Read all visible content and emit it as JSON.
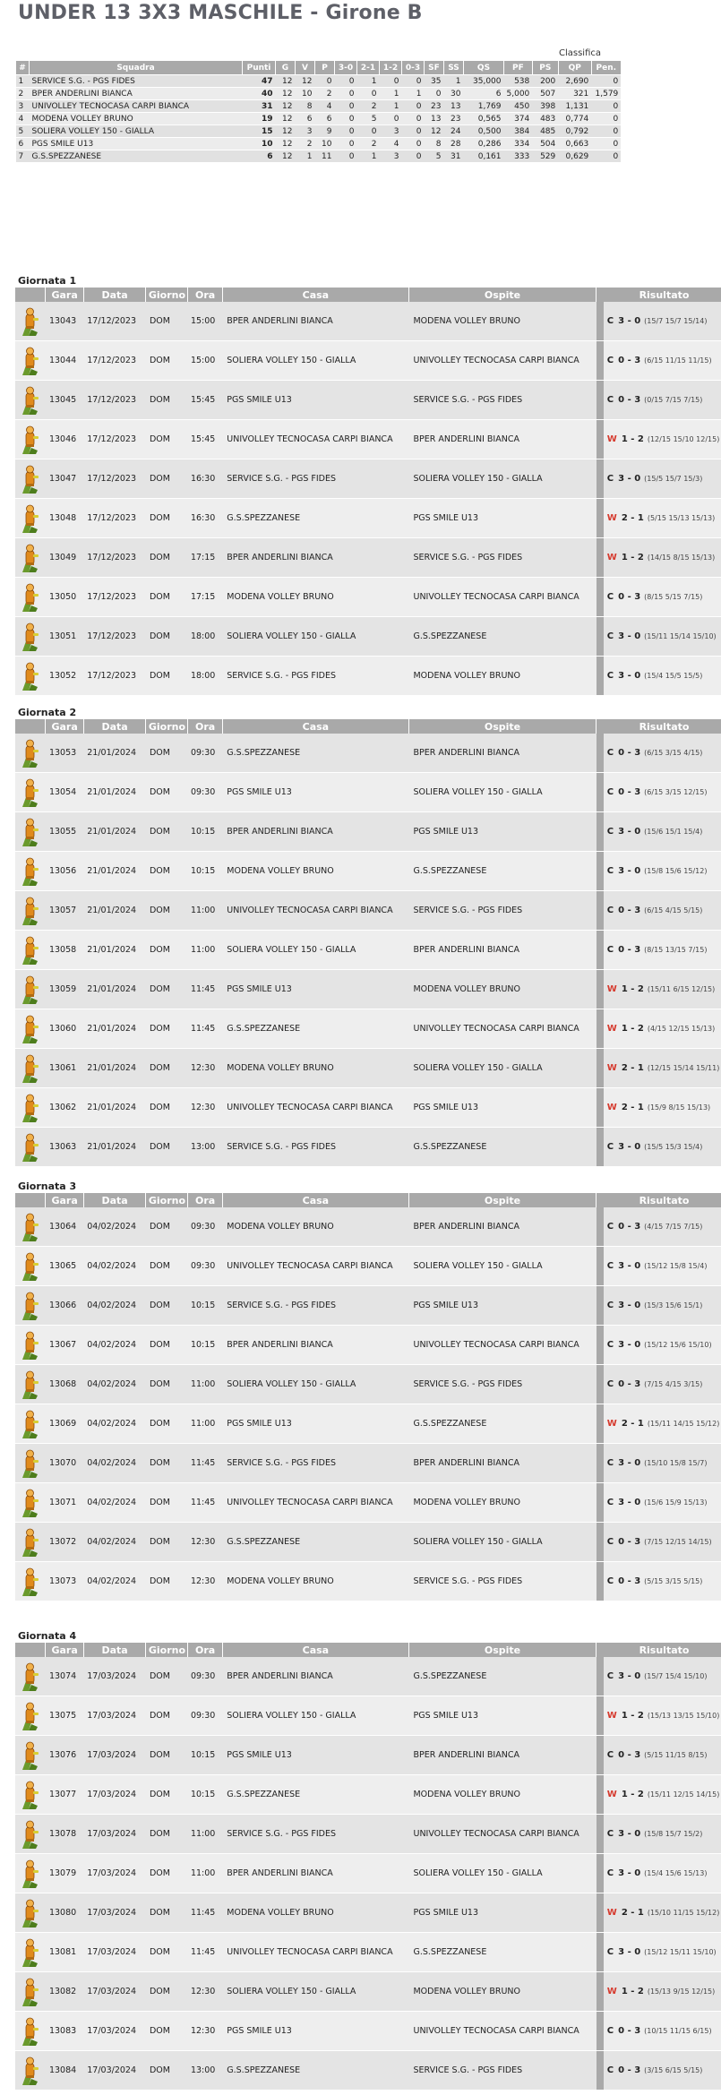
{
  "title": "UNDER 13 3X3 MASCHILE - Girone B",
  "standings_caption": "Classifica",
  "standings_headers": [
    "#",
    "Squadra",
    "Punti",
    "G",
    "V",
    "P",
    "3-0",
    "2-1",
    "1-2",
    "0-3",
    "SF",
    "SS",
    "QS",
    "PF",
    "PS",
    "QP",
    "Pen."
  ],
  "standings": [
    {
      "rank": "1",
      "team": "SERVICE S.G. - PGS FIDES",
      "punti": "47",
      "g": "12",
      "v": "12",
      "p": "0",
      "s30": "0",
      "s21": "1",
      "s12": "0",
      "s03": "0",
      "sf": "35",
      "ss": "1",
      "qs": "35,000",
      "pf": "538",
      "ps": "200",
      "qp": "2,690",
      "pen": "0"
    },
    {
      "rank": "2",
      "team": "BPER ANDERLINI BIANCA",
      "punti": "40",
      "g": "12",
      "v": "10",
      "p": "2",
      "s30": "0",
      "s21": "0",
      "s12": "1",
      "s03": "1",
      "sf": "0",
      "ss": "30",
      "qs": "6",
      "pf": "5,000",
      "ps": "507",
      "qp": "321",
      "pen": "1,579",
      "pen2": "0"
    },
    {
      "rank": "3",
      "team": "UNIVOLLEY TECNOCASA CARPI BIANCA",
      "punti": "31",
      "g": "12",
      "v": "8",
      "p": "4",
      "s30": "0",
      "s21": "2",
      "s12": "1",
      "s03": "0",
      "sf": "23",
      "ss": "13",
      "qs": "1,769",
      "pf": "450",
      "ps": "398",
      "qp": "1,131",
      "pen": "0"
    },
    {
      "rank": "4",
      "team": "MODENA VOLLEY BRUNO",
      "punti": "19",
      "g": "12",
      "v": "6",
      "p": "6",
      "s30": "0",
      "s21": "5",
      "s12": "0",
      "s03": "0",
      "sf": "13",
      "ss": "23",
      "qs": "0,565",
      "pf": "374",
      "ps": "483",
      "qp": "0,774",
      "pen": "0"
    },
    {
      "rank": "5",
      "team": "SOLIERA VOLLEY 150 - GIALLA",
      "punti": "15",
      "g": "12",
      "v": "3",
      "p": "9",
      "s30": "0",
      "s21": "0",
      "s12": "3",
      "s03": "0",
      "sf": "12",
      "ss": "24",
      "qs": "0,500",
      "pf": "384",
      "ps": "485",
      "qp": "0,792",
      "pen": "0"
    },
    {
      "rank": "6",
      "team": "PGS SMILE U13",
      "punti": "10",
      "g": "12",
      "v": "2",
      "p": "10",
      "s30": "0",
      "s21": "2",
      "s12": "4",
      "s03": "0",
      "sf": "8",
      "ss": "28",
      "qs": "0,286",
      "pf": "334",
      "ps": "504",
      "qp": "0,663",
      "pen": "0"
    },
    {
      "rank": "7",
      "team": "G.S.SPEZZANESE",
      "punti": "6",
      "g": "12",
      "v": "1",
      "p": "11",
      "s30": "0",
      "s21": "1",
      "s12": "3",
      "s03": "0",
      "sf": "5",
      "ss": "31",
      "qs": "0,161",
      "pf": "333",
      "ps": "529",
      "qp": "0,629",
      "pen": "0"
    }
  ],
  "games_headers": [
    "Gara",
    "Data",
    "Giorno",
    "Ora",
    "Casa",
    "Ospite",
    "Risultato"
  ],
  "giornate": [
    {
      "label": "Giornata 1",
      "games": [
        {
          "gara": "13043",
          "data": "17/12/2023",
          "giorno": "DOM",
          "ora": "15:00",
          "casa": "BPER ANDERLINI BIANCA",
          "ospite": "MODENA VOLLEY BRUNO",
          "flag": "C",
          "score": "3 - 0",
          "sets": "(15/7 15/7 15/14)"
        },
        {
          "gara": "13044",
          "data": "17/12/2023",
          "giorno": "DOM",
          "ora": "15:00",
          "casa": "SOLIERA VOLLEY 150 - GIALLA",
          "ospite": "UNIVOLLEY TECNOCASA CARPI BIANCA",
          "flag": "C",
          "score": "0 - 3",
          "sets": "(6/15 11/15 11/15)"
        },
        {
          "gara": "13045",
          "data": "17/12/2023",
          "giorno": "DOM",
          "ora": "15:45",
          "casa": "PGS SMILE U13",
          "ospite": "SERVICE S.G. - PGS FIDES",
          "flag": "C",
          "score": "0 - 3",
          "sets": "(0/15 7/15 7/15)"
        },
        {
          "gara": "13046",
          "data": "17/12/2023",
          "giorno": "DOM",
          "ora": "15:45",
          "casa": "UNIVOLLEY TECNOCASA CARPI BIANCA",
          "ospite": "BPER ANDERLINI BIANCA",
          "flag": "W",
          "score": "1 - 2",
          "sets": "(12/15 15/10 12/15)"
        },
        {
          "gara": "13047",
          "data": "17/12/2023",
          "giorno": "DOM",
          "ora": "16:30",
          "casa": "SERVICE S.G. - PGS FIDES",
          "ospite": "SOLIERA VOLLEY 150 - GIALLA",
          "flag": "C",
          "score": "3 - 0",
          "sets": "(15/5 15/7 15/3)"
        },
        {
          "gara": "13048",
          "data": "17/12/2023",
          "giorno": "DOM",
          "ora": "16:30",
          "casa": "G.S.SPEZZANESE",
          "ospite": "PGS SMILE U13",
          "flag": "W",
          "score": "2 - 1",
          "sets": "(5/15 15/13 15/13)"
        },
        {
          "gara": "13049",
          "data": "17/12/2023",
          "giorno": "DOM",
          "ora": "17:15",
          "casa": "BPER ANDERLINI BIANCA",
          "ospite": "SERVICE S.G. - PGS FIDES",
          "flag": "W",
          "score": "1 - 2",
          "sets": "(14/15 8/15 15/13)"
        },
        {
          "gara": "13050",
          "data": "17/12/2023",
          "giorno": "DOM",
          "ora": "17:15",
          "casa": "MODENA VOLLEY BRUNO",
          "ospite": "UNIVOLLEY TECNOCASA CARPI BIANCA",
          "flag": "C",
          "score": "0 - 3",
          "sets": "(8/15 5/15 7/15)"
        },
        {
          "gara": "13051",
          "data": "17/12/2023",
          "giorno": "DOM",
          "ora": "18:00",
          "casa": "SOLIERA VOLLEY 150 - GIALLA",
          "ospite": "G.S.SPEZZANESE",
          "flag": "C",
          "score": "3 - 0",
          "sets": "(15/11 15/14 15/10)"
        },
        {
          "gara": "13052",
          "data": "17/12/2023",
          "giorno": "DOM",
          "ora": "18:00",
          "casa": "SERVICE S.G. - PGS FIDES",
          "ospite": "MODENA VOLLEY BRUNO",
          "flag": "C",
          "score": "3 - 0",
          "sets": "(15/4 15/5 15/5)"
        }
      ]
    },
    {
      "label": "Giornata 2",
      "games": [
        {
          "gara": "13053",
          "data": "21/01/2024",
          "giorno": "DOM",
          "ora": "09:30",
          "casa": "G.S.SPEZZANESE",
          "ospite": "BPER ANDERLINI BIANCA",
          "flag": "C",
          "score": "0 - 3",
          "sets": "(6/15 3/15 4/15)"
        },
        {
          "gara": "13054",
          "data": "21/01/2024",
          "giorno": "DOM",
          "ora": "09:30",
          "casa": "PGS SMILE U13",
          "ospite": "SOLIERA VOLLEY 150 - GIALLA",
          "flag": "C",
          "score": "0 - 3",
          "sets": "(6/15 3/15 12/15)"
        },
        {
          "gara": "13055",
          "data": "21/01/2024",
          "giorno": "DOM",
          "ora": "10:15",
          "casa": "BPER ANDERLINI BIANCA",
          "ospite": "PGS SMILE U13",
          "flag": "C",
          "score": "3 - 0",
          "sets": "(15/6 15/1 15/4)"
        },
        {
          "gara": "13056",
          "data": "21/01/2024",
          "giorno": "DOM",
          "ora": "10:15",
          "casa": "MODENA VOLLEY BRUNO",
          "ospite": "G.S.SPEZZANESE",
          "flag": "C",
          "score": "3 - 0",
          "sets": "(15/8 15/6 15/12)"
        },
        {
          "gara": "13057",
          "data": "21/01/2024",
          "giorno": "DOM",
          "ora": "11:00",
          "casa": "UNIVOLLEY TECNOCASA CARPI BIANCA",
          "ospite": "SERVICE S.G. - PGS FIDES",
          "flag": "C",
          "score": "0 - 3",
          "sets": "(6/15 4/15 5/15)"
        },
        {
          "gara": "13058",
          "data": "21/01/2024",
          "giorno": "DOM",
          "ora": "11:00",
          "casa": "SOLIERA VOLLEY 150 - GIALLA",
          "ospite": "BPER ANDERLINI BIANCA",
          "flag": "C",
          "score": "0 - 3",
          "sets": "(8/15 13/15 7/15)"
        },
        {
          "gara": "13059",
          "data": "21/01/2024",
          "giorno": "DOM",
          "ora": "11:45",
          "casa": "PGS SMILE U13",
          "ospite": "MODENA VOLLEY BRUNO",
          "flag": "W",
          "score": "1 - 2",
          "sets": "(15/11 6/15 12/15)"
        },
        {
          "gara": "13060",
          "data": "21/01/2024",
          "giorno": "DOM",
          "ora": "11:45",
          "casa": "G.S.SPEZZANESE",
          "ospite": "UNIVOLLEY TECNOCASA CARPI BIANCA",
          "flag": "W",
          "score": "1 - 2",
          "sets": "(4/15 12/15 15/13)"
        },
        {
          "gara": "13061",
          "data": "21/01/2024",
          "giorno": "DOM",
          "ora": "12:30",
          "casa": "MODENA VOLLEY BRUNO",
          "ospite": "SOLIERA VOLLEY 150 - GIALLA",
          "flag": "W",
          "score": "2 - 1",
          "sets": "(12/15 15/14 15/11)"
        },
        {
          "gara": "13062",
          "data": "21/01/2024",
          "giorno": "DOM",
          "ora": "12:30",
          "casa": "UNIVOLLEY TECNOCASA CARPI BIANCA",
          "ospite": "PGS SMILE U13",
          "flag": "W",
          "score": "2 - 1",
          "sets": "(15/9 8/15 15/13)"
        },
        {
          "gara": "13063",
          "data": "21/01/2024",
          "giorno": "DOM",
          "ora": "13:00",
          "casa": "SERVICE S.G. - PGS FIDES",
          "ospite": "G.S.SPEZZANESE",
          "flag": "C",
          "score": "3 - 0",
          "sets": "(15/5 15/3 15/4)"
        }
      ]
    },
    {
      "label": "Giornata 3",
      "games": [
        {
          "gara": "13064",
          "data": "04/02/2024",
          "giorno": "DOM",
          "ora": "09:30",
          "casa": "MODENA VOLLEY BRUNO",
          "ospite": "BPER ANDERLINI BIANCA",
          "flag": "C",
          "score": "0 - 3",
          "sets": "(4/15 7/15 7/15)"
        },
        {
          "gara": "13065",
          "data": "04/02/2024",
          "giorno": "DOM",
          "ora": "09:30",
          "casa": "UNIVOLLEY TECNOCASA CARPI BIANCA",
          "ospite": "SOLIERA VOLLEY 150 - GIALLA",
          "flag": "C",
          "score": "3 - 0",
          "sets": "(15/12 15/8 15/4)"
        },
        {
          "gara": "13066",
          "data": "04/02/2024",
          "giorno": "DOM",
          "ora": "10:15",
          "casa": "SERVICE S.G. - PGS FIDES",
          "ospite": "PGS SMILE U13",
          "flag": "C",
          "score": "3 - 0",
          "sets": "(15/3 15/6 15/1)"
        },
        {
          "gara": "13067",
          "data": "04/02/2024",
          "giorno": "DOM",
          "ora": "10:15",
          "casa": "BPER ANDERLINI BIANCA",
          "ospite": "UNIVOLLEY TECNOCASA CARPI BIANCA",
          "flag": "C",
          "score": "3 - 0",
          "sets": "(15/12 15/6 15/10)"
        },
        {
          "gara": "13068",
          "data": "04/02/2024",
          "giorno": "DOM",
          "ora": "11:00",
          "casa": "SOLIERA VOLLEY 150 - GIALLA",
          "ospite": "SERVICE S.G. - PGS FIDES",
          "flag": "C",
          "score": "0 - 3",
          "sets": "(7/15 4/15 3/15)"
        },
        {
          "gara": "13069",
          "data": "04/02/2024",
          "giorno": "DOM",
          "ora": "11:00",
          "casa": "PGS SMILE U13",
          "ospite": "G.S.SPEZZANESE",
          "flag": "W",
          "score": "2 - 1",
          "sets": "(15/11 14/15 15/12)"
        },
        {
          "gara": "13070",
          "data": "04/02/2024",
          "giorno": "DOM",
          "ora": "11:45",
          "casa": "SERVICE S.G. - PGS FIDES",
          "ospite": "BPER ANDERLINI BIANCA",
          "flag": "C",
          "score": "3 - 0",
          "sets": "(15/10 15/8 15/7)"
        },
        {
          "gara": "13071",
          "data": "04/02/2024",
          "giorno": "DOM",
          "ora": "11:45",
          "casa": "UNIVOLLEY TECNOCASA CARPI BIANCA",
          "ospite": "MODENA VOLLEY BRUNO",
          "flag": "C",
          "score": "3 - 0",
          "sets": "(15/6 15/9 15/13)"
        },
        {
          "gara": "13072",
          "data": "04/02/2024",
          "giorno": "DOM",
          "ora": "12:30",
          "casa": "G.S.SPEZZANESE",
          "ospite": "SOLIERA VOLLEY 150 - GIALLA",
          "flag": "C",
          "score": "0 - 3",
          "sets": "(7/15 12/15 14/15)"
        },
        {
          "gara": "13073",
          "data": "04/02/2024",
          "giorno": "DOM",
          "ora": "12:30",
          "casa": "MODENA VOLLEY BRUNO",
          "ospite": "SERVICE S.G. - PGS FIDES",
          "flag": "C",
          "score": "0 - 3",
          "sets": "(5/15 3/15 5/15)"
        }
      ]
    },
    {
      "label": "Giornata 4",
      "games": [
        {
          "gara": "13074",
          "data": "17/03/2024",
          "giorno": "DOM",
          "ora": "09:30",
          "casa": "BPER ANDERLINI BIANCA",
          "ospite": "G.S.SPEZZANESE",
          "flag": "C",
          "score": "3 - 0",
          "sets": "(15/7 15/4 15/10)"
        },
        {
          "gara": "13075",
          "data": "17/03/2024",
          "giorno": "DOM",
          "ora": "09:30",
          "casa": "SOLIERA VOLLEY 150 - GIALLA",
          "ospite": "PGS SMILE U13",
          "flag": "W",
          "score": "1 - 2",
          "sets": "(15/13 13/15 15/10)"
        },
        {
          "gara": "13076",
          "data": "17/03/2024",
          "giorno": "DOM",
          "ora": "10:15",
          "casa": "PGS SMILE U13",
          "ospite": "BPER ANDERLINI BIANCA",
          "flag": "C",
          "score": "0 - 3",
          "sets": "(5/15 11/15 8/15)"
        },
        {
          "gara": "13077",
          "data": "17/03/2024",
          "giorno": "DOM",
          "ora": "10:15",
          "casa": "G.S.SPEZZANESE",
          "ospite": "MODENA VOLLEY BRUNO",
          "flag": "W",
          "score": "1 - 2",
          "sets": "(15/11 12/15 14/15)"
        },
        {
          "gara": "13078",
          "data": "17/03/2024",
          "giorno": "DOM",
          "ora": "11:00",
          "casa": "SERVICE S.G. - PGS FIDES",
          "ospite": "UNIVOLLEY TECNOCASA CARPI BIANCA",
          "flag": "C",
          "score": "3 - 0",
          "sets": "(15/8 15/7 15/2)"
        },
        {
          "gara": "13079",
          "data": "17/03/2024",
          "giorno": "DOM",
          "ora": "11:00",
          "casa": "BPER ANDERLINI BIANCA",
          "ospite": "SOLIERA VOLLEY 150 - GIALLA",
          "flag": "C",
          "score": "3 - 0",
          "sets": "(15/4 15/6 15/13)"
        },
        {
          "gara": "13080",
          "data": "17/03/2024",
          "giorno": "DOM",
          "ora": "11:45",
          "casa": "MODENA VOLLEY BRUNO",
          "ospite": "PGS SMILE U13",
          "flag": "W",
          "score": "2 - 1",
          "sets": "(15/10 11/15 15/12)"
        },
        {
          "gara": "13081",
          "data": "17/03/2024",
          "giorno": "DOM",
          "ora": "11:45",
          "casa": "UNIVOLLEY TECNOCASA CARPI BIANCA",
          "ospite": "G.S.SPEZZANESE",
          "flag": "C",
          "score": "3 - 0",
          "sets": "(15/12 15/11 15/10)"
        },
        {
          "gara": "13082",
          "data": "17/03/2024",
          "giorno": "DOM",
          "ora": "12:30",
          "casa": "SOLIERA VOLLEY 150 - GIALLA",
          "ospite": "MODENA VOLLEY BRUNO",
          "flag": "W",
          "score": "1 - 2",
          "sets": "(15/13 9/15 12/15)"
        },
        {
          "gara": "13083",
          "data": "17/03/2024",
          "giorno": "DOM",
          "ora": "12:30",
          "casa": "PGS SMILE U13",
          "ospite": "UNIVOLLEY TECNOCASA CARPI BIANCA",
          "flag": "C",
          "score": "0 - 3",
          "sets": "(10/15 11/15 6/15)"
        },
        {
          "gara": "13084",
          "data": "17/03/2024",
          "giorno": "DOM",
          "ora": "13:00",
          "casa": "G.S.SPEZZANESE",
          "ospite": "SERVICE S.G. - PGS FIDES",
          "flag": "C",
          "score": "0 - 3",
          "sets": "(3/15 6/15 5/15)"
        }
      ]
    }
  ],
  "colors": {
    "header_bg": "#a9a9a9",
    "row_a": "#e4e4e4",
    "row_b": "#eeeeee",
    "win_flag": "#d63a2e",
    "title": "#5e6068"
  },
  "icons": {
    "match_icon": "referee-whistle-figure-icon"
  }
}
